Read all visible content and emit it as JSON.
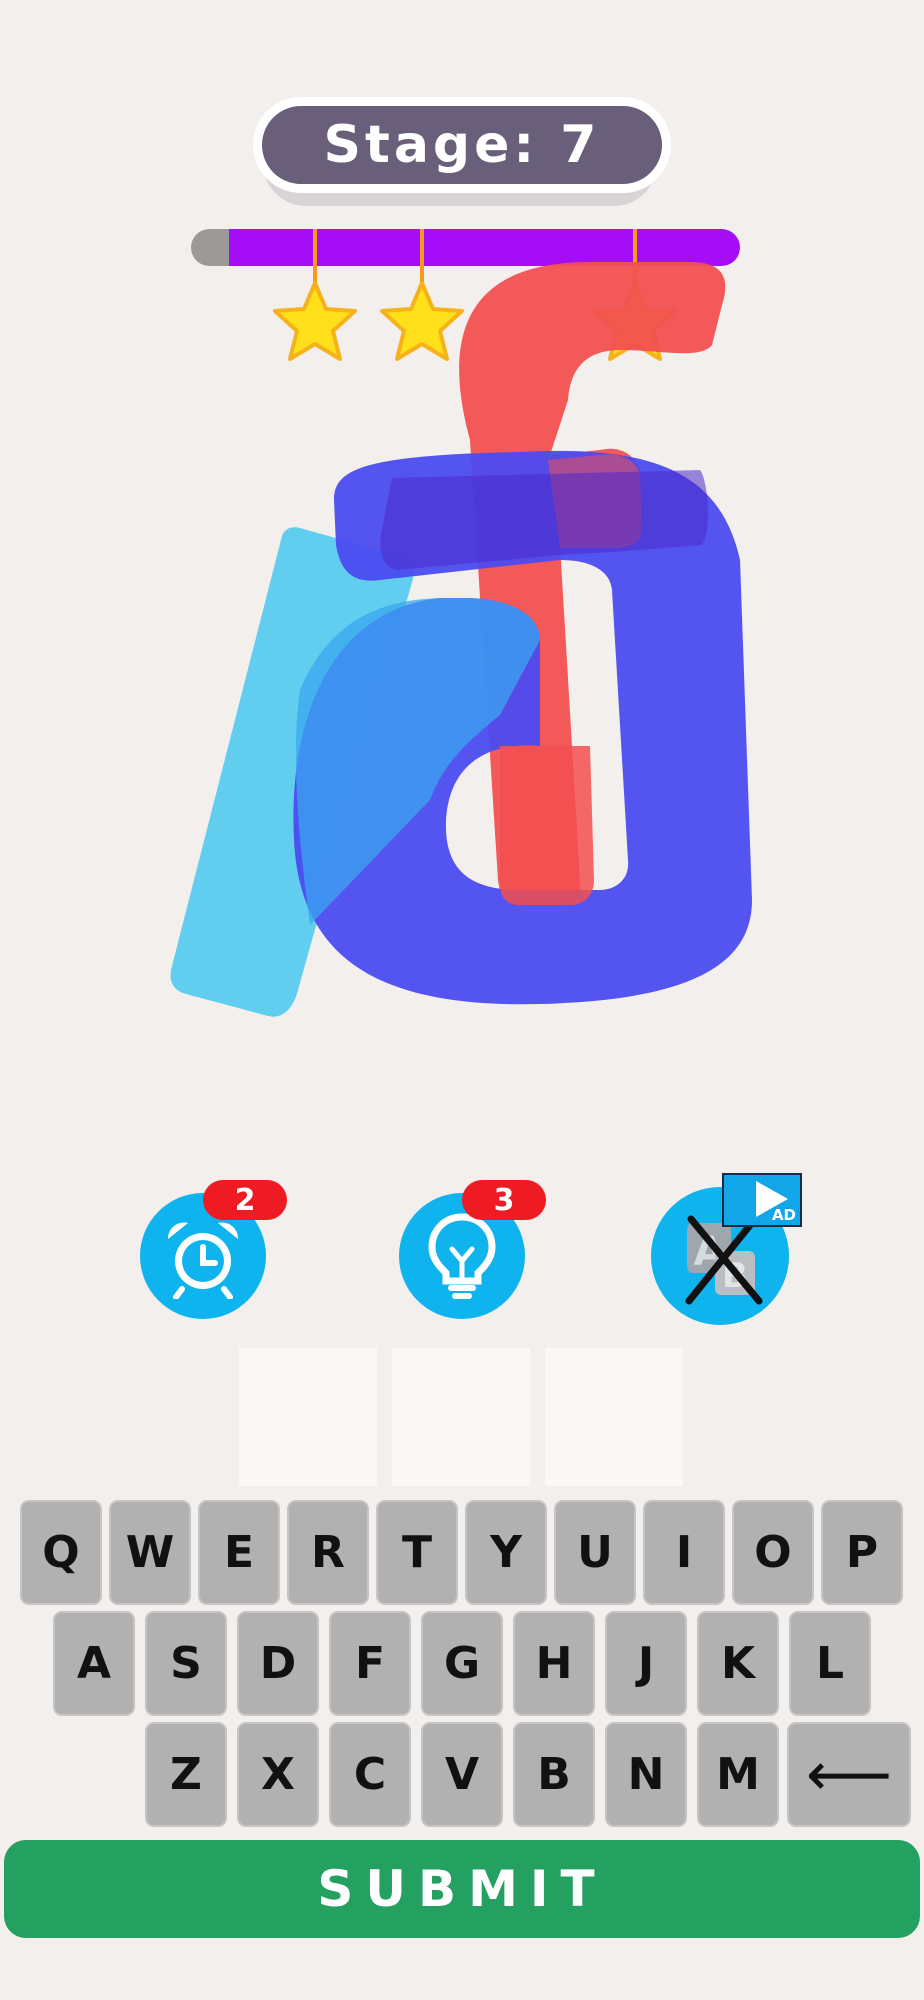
{
  "header": {
    "stage_label": "Stage: 7"
  },
  "progress": {
    "fraction": 0.93,
    "stars_earned": 3
  },
  "colors": {
    "stage_pill": "#6a5f7a",
    "progress_fill": "#a60df7",
    "star": "#ffe01b",
    "powerup": "#0fb4ef",
    "badge": "#ee1b22",
    "submit": "#24a060",
    "logo_red": "#f25050",
    "logo_blue": "#4b4bf0",
    "logo_light_blue": "#55cbf0"
  },
  "powerups": [
    {
      "icon": "alarm-clock-icon",
      "count": "2"
    },
    {
      "icon": "lightbulb-icon",
      "count": "3"
    },
    {
      "icon": "remove-letters-icon",
      "ad_label": "AD"
    }
  ],
  "answer": {
    "slots": [
      "",
      "",
      ""
    ]
  },
  "keyboard": {
    "row1": [
      "Q",
      "W",
      "E",
      "R",
      "T",
      "Y",
      "U",
      "I",
      "O",
      "P"
    ],
    "row2": [
      "A",
      "S",
      "D",
      "F",
      "G",
      "H",
      "J",
      "K",
      "L"
    ],
    "row3": [
      "Z",
      "X",
      "C",
      "V",
      "B",
      "N",
      "M"
    ],
    "backspace": "⟵"
  },
  "submit_label": "SUBMIT"
}
